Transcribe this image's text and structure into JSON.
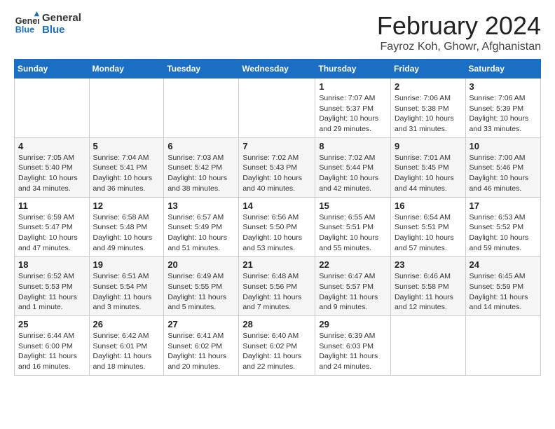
{
  "logo": {
    "line1": "General",
    "line2": "Blue"
  },
  "title": "February 2024",
  "subtitle": "Fayroz Koh, Ghowr, Afghanistan",
  "days_of_week": [
    "Sunday",
    "Monday",
    "Tuesday",
    "Wednesday",
    "Thursday",
    "Friday",
    "Saturday"
  ],
  "weeks": [
    [
      {
        "day": "",
        "info": ""
      },
      {
        "day": "",
        "info": ""
      },
      {
        "day": "",
        "info": ""
      },
      {
        "day": "",
        "info": ""
      },
      {
        "day": "1",
        "info": "Sunrise: 7:07 AM\nSunset: 5:37 PM\nDaylight: 10 hours and 29 minutes."
      },
      {
        "day": "2",
        "info": "Sunrise: 7:06 AM\nSunset: 5:38 PM\nDaylight: 10 hours and 31 minutes."
      },
      {
        "day": "3",
        "info": "Sunrise: 7:06 AM\nSunset: 5:39 PM\nDaylight: 10 hours and 33 minutes."
      }
    ],
    [
      {
        "day": "4",
        "info": "Sunrise: 7:05 AM\nSunset: 5:40 PM\nDaylight: 10 hours and 34 minutes."
      },
      {
        "day": "5",
        "info": "Sunrise: 7:04 AM\nSunset: 5:41 PM\nDaylight: 10 hours and 36 minutes."
      },
      {
        "day": "6",
        "info": "Sunrise: 7:03 AM\nSunset: 5:42 PM\nDaylight: 10 hours and 38 minutes."
      },
      {
        "day": "7",
        "info": "Sunrise: 7:02 AM\nSunset: 5:43 PM\nDaylight: 10 hours and 40 minutes."
      },
      {
        "day": "8",
        "info": "Sunrise: 7:02 AM\nSunset: 5:44 PM\nDaylight: 10 hours and 42 minutes."
      },
      {
        "day": "9",
        "info": "Sunrise: 7:01 AM\nSunset: 5:45 PM\nDaylight: 10 hours and 44 minutes."
      },
      {
        "day": "10",
        "info": "Sunrise: 7:00 AM\nSunset: 5:46 PM\nDaylight: 10 hours and 46 minutes."
      }
    ],
    [
      {
        "day": "11",
        "info": "Sunrise: 6:59 AM\nSunset: 5:47 PM\nDaylight: 10 hours and 47 minutes."
      },
      {
        "day": "12",
        "info": "Sunrise: 6:58 AM\nSunset: 5:48 PM\nDaylight: 10 hours and 49 minutes."
      },
      {
        "day": "13",
        "info": "Sunrise: 6:57 AM\nSunset: 5:49 PM\nDaylight: 10 hours and 51 minutes."
      },
      {
        "day": "14",
        "info": "Sunrise: 6:56 AM\nSunset: 5:50 PM\nDaylight: 10 hours and 53 minutes."
      },
      {
        "day": "15",
        "info": "Sunrise: 6:55 AM\nSunset: 5:51 PM\nDaylight: 10 hours and 55 minutes."
      },
      {
        "day": "16",
        "info": "Sunrise: 6:54 AM\nSunset: 5:51 PM\nDaylight: 10 hours and 57 minutes."
      },
      {
        "day": "17",
        "info": "Sunrise: 6:53 AM\nSunset: 5:52 PM\nDaylight: 10 hours and 59 minutes."
      }
    ],
    [
      {
        "day": "18",
        "info": "Sunrise: 6:52 AM\nSunset: 5:53 PM\nDaylight: 11 hours and 1 minute."
      },
      {
        "day": "19",
        "info": "Sunrise: 6:51 AM\nSunset: 5:54 PM\nDaylight: 11 hours and 3 minutes."
      },
      {
        "day": "20",
        "info": "Sunrise: 6:49 AM\nSunset: 5:55 PM\nDaylight: 11 hours and 5 minutes."
      },
      {
        "day": "21",
        "info": "Sunrise: 6:48 AM\nSunset: 5:56 PM\nDaylight: 11 hours and 7 minutes."
      },
      {
        "day": "22",
        "info": "Sunrise: 6:47 AM\nSunset: 5:57 PM\nDaylight: 11 hours and 9 minutes."
      },
      {
        "day": "23",
        "info": "Sunrise: 6:46 AM\nSunset: 5:58 PM\nDaylight: 11 hours and 12 minutes."
      },
      {
        "day": "24",
        "info": "Sunrise: 6:45 AM\nSunset: 5:59 PM\nDaylight: 11 hours and 14 minutes."
      }
    ],
    [
      {
        "day": "25",
        "info": "Sunrise: 6:44 AM\nSunset: 6:00 PM\nDaylight: 11 hours and 16 minutes."
      },
      {
        "day": "26",
        "info": "Sunrise: 6:42 AM\nSunset: 6:01 PM\nDaylight: 11 hours and 18 minutes."
      },
      {
        "day": "27",
        "info": "Sunrise: 6:41 AM\nSunset: 6:02 PM\nDaylight: 11 hours and 20 minutes."
      },
      {
        "day": "28",
        "info": "Sunrise: 6:40 AM\nSunset: 6:02 PM\nDaylight: 11 hours and 22 minutes."
      },
      {
        "day": "29",
        "info": "Sunrise: 6:39 AM\nSunset: 6:03 PM\nDaylight: 11 hours and 24 minutes."
      },
      {
        "day": "",
        "info": ""
      },
      {
        "day": "",
        "info": ""
      }
    ]
  ]
}
